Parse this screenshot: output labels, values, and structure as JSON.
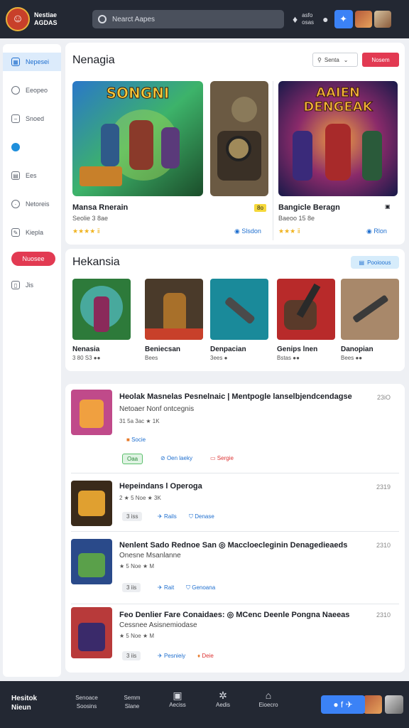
{
  "header": {
    "brand": "Nestiae\nAGDAS",
    "search_placeholder": "Nearct Aapes",
    "info_text": "asfo\nosas",
    "colors": {
      "bar": "#232833",
      "accent": "#3b82f6",
      "red": "#e23a52"
    }
  },
  "sidebar": {
    "items": [
      {
        "label": "Nepesei",
        "icon": "grid-icon",
        "active": true
      },
      {
        "label": "Eeopeo",
        "icon": "clock-icon"
      },
      {
        "label": "Snoed",
        "icon": "box-icon"
      },
      {
        "label": "",
        "icon": "dot-icon"
      },
      {
        "label": "Ees",
        "icon": "calendar-icon"
      },
      {
        "label": "Netoreis",
        "icon": "gear-icon"
      },
      {
        "label": "Kiepla",
        "icon": "edit-icon"
      }
    ],
    "red_button": "Nuosee",
    "last_item": "Jis"
  },
  "featured": {
    "title": "Nenagia",
    "sort_label": "Senta",
    "red_button": "Nosem",
    "cards": [
      {
        "name": "Mansa Rnerain",
        "sub": "Seolie 3 8ae",
        "rating": "★★★★ ⅱ",
        "badge": "8o",
        "link": "Slsdon",
        "art_title": "SONGNI"
      },
      {
        "name": "Bangicle Beragn",
        "sub": "Baeoo 15 8e",
        "rating": "★★★ ⅱ",
        "badge": "",
        "link": "Rlon",
        "art_title": "AAIEN DENGEAK"
      }
    ]
  },
  "collection": {
    "title": "Hekansia",
    "button": "Pooioous",
    "tiles": [
      {
        "name": "Nenasia",
        "sub": "3 80 S3 ●●"
      },
      {
        "name": "Beniecsan",
        "sub": "Bees"
      },
      {
        "name": "Denpacian",
        "sub": "3ees ●"
      },
      {
        "name": "Genips lnen",
        "sub": "Bstas ●●"
      },
      {
        "name": "Danopian",
        "sub": "Bees ●●"
      }
    ]
  },
  "list": {
    "items": [
      {
        "title": "Heolak Masnelas Pesnelnaic | Mentpogle lanselbjendcendagse",
        "sub": "Netoaer Nonf ontcegnis",
        "meta": "31 5a 3ac ★ 1K",
        "date": "23iO",
        "chips": [
          "Socie",
          "Oaa",
          "Oen laeky",
          "Sergie"
        ]
      },
      {
        "title": "Hepeindans l Operoga",
        "sub": "",
        "meta": "2 ★ 5 Noe ★ 3K",
        "date": "2319",
        "chips": [
          "3 iss",
          "Rails",
          "Denase"
        ]
      },
      {
        "title": "Nenlent Sado Rednoe San ◎ Maccloecleginin Denagedieaeds",
        "sub": "Onesne Msanlanne",
        "meta": "★ 5 Noe ★ M",
        "date": "2310",
        "chips": [
          "3 iis",
          "Rait",
          "Genoana"
        ]
      },
      {
        "title": "Feo Denlier Fare Conaidaes: ◎ MCenc Deenle Pongna Naeeas",
        "sub": "Cessnee Asisnemiodase",
        "meta": "★ 5 Noe ★ M",
        "date": "2310",
        "chips": [
          "3 iis",
          "Pesnieiy",
          "Deie"
        ]
      }
    ]
  },
  "bottom": {
    "brand": "Hesitok\nNieun",
    "items": [
      {
        "label": "Senoace\nSoosins"
      },
      {
        "label": "Semm\nSlane"
      },
      {
        "label": "Aeciss"
      },
      {
        "label": "Aedis"
      },
      {
        "label": "Eioecro"
      }
    ]
  }
}
